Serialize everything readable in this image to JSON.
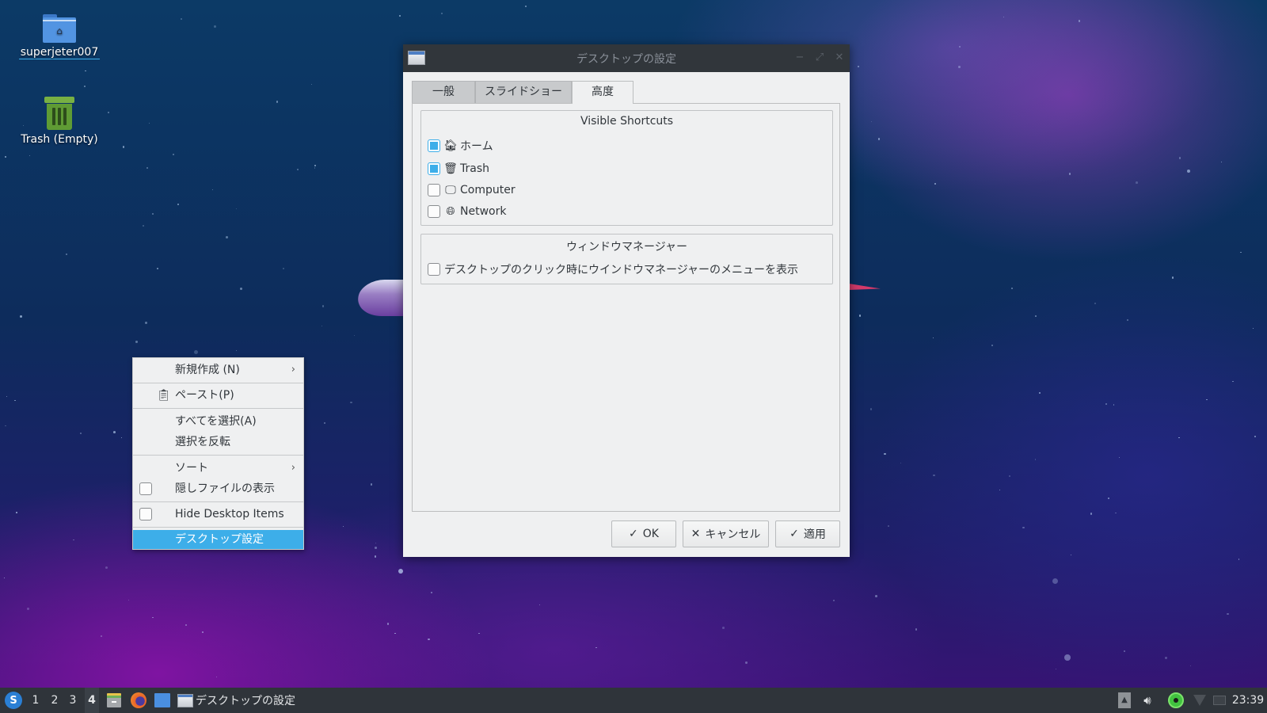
{
  "desktop": {
    "icons": [
      {
        "label": "superjeter007",
        "icon": "home-folder-icon",
        "selected": true
      },
      {
        "label": "Trash (Empty)",
        "icon": "trash-icon",
        "selected": false
      }
    ]
  },
  "dialog": {
    "title": "デスクトップの設定",
    "window_buttons": {
      "minimize": "−",
      "maximize": "⤢",
      "close": "✕"
    },
    "tabs": [
      {
        "label": "一般",
        "active": false
      },
      {
        "label": "スライドショー",
        "active": false
      },
      {
        "label": "高度",
        "active": true
      }
    ],
    "visible_shortcuts": {
      "title": "Visible Shortcuts",
      "items": [
        {
          "label": "ホーム",
          "icon": "home-icon",
          "glyph": "🏠︎",
          "checked": true
        },
        {
          "label": "Trash",
          "icon": "trash-icon",
          "glyph": "🗑︎",
          "checked": true
        },
        {
          "label": "Computer",
          "icon": "computer-icon",
          "glyph": "🖵",
          "checked": false
        },
        {
          "label": "Network",
          "icon": "network-globe-icon",
          "glyph": "🌐︎",
          "checked": false
        }
      ]
    },
    "window_manager": {
      "title": "ウィンドウマネージャー",
      "option": {
        "label": "デスクトップのクリック時にウインドウマネージャーのメニューを表示",
        "checked": false
      }
    },
    "buttons": {
      "ok": {
        "label": "OK",
        "icon": "✓"
      },
      "cancel": {
        "label": "キャンセル",
        "icon": "✕"
      },
      "apply": {
        "label": "適用",
        "icon": "✓"
      }
    }
  },
  "context_menu": {
    "items": [
      {
        "label": "新規作成 (N)",
        "submenu": true
      },
      {
        "label": "ペースト(P)",
        "icon": "clipboard-icon",
        "glyph": "📋︎"
      },
      {
        "label": "すべてを選択(A)"
      },
      {
        "label": "選択を反転"
      },
      {
        "label": "ソート",
        "submenu": true
      },
      {
        "label": "隠しファイルの表示",
        "checkbox": true,
        "checked": false
      },
      {
        "label": "Hide Desktop Items",
        "checkbox": true,
        "checked": false
      },
      {
        "label": "デスクトップ設定",
        "highlighted": true
      }
    ],
    "chevron": "›"
  },
  "taskbar": {
    "launcher_glyph": "S",
    "workspaces": [
      "1",
      "2",
      "3",
      "4"
    ],
    "active_workspace": "4",
    "task_title": "デスクトップの設定",
    "tray": {
      "eject": "▲",
      "volume": "🔊︎"
    },
    "clock": "23:39"
  },
  "colors": {
    "accent": "#3daee9",
    "titlebar": "#31363b",
    "dialog_bg": "#eff0f1",
    "taskbar": "#2f343a"
  }
}
